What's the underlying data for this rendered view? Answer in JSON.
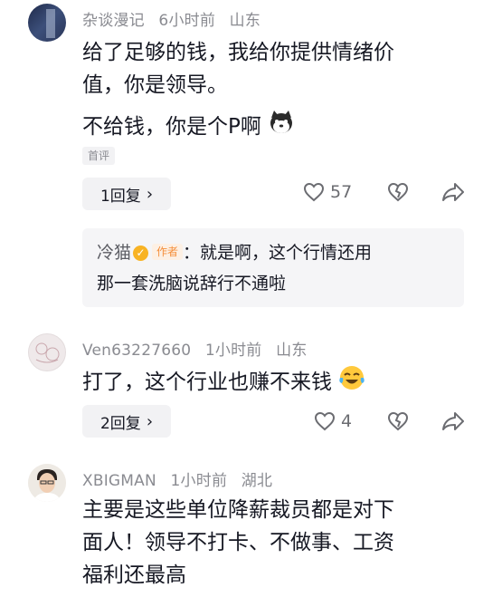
{
  "comments": [
    {
      "username": "杂谈漫记",
      "time": "6小时前",
      "location": "山东",
      "text_line1": "给了足够的钱，我给你提供情绪价",
      "text_line2": "值，你是领导。",
      "text_line3": "不给钱，你是个P啊",
      "tag": "首评",
      "replies_label": "1回复",
      "likes": "57",
      "reply": {
        "author": "冷猫",
        "author_tag": "作者",
        "line1": "：就是啊，这个行情还用",
        "line2": "那一套洗脑说辞行不通啦"
      }
    },
    {
      "username": "Ven63227660",
      "time": "1小时前",
      "location": "山东",
      "text_line1": "打了，这个行业也赚不来钱",
      "replies_label": "2回复",
      "likes": "4"
    },
    {
      "username": "XBIGMAN",
      "time": "1小时前",
      "location": "湖北",
      "text_line1": "主要是这些单位降薪裁员都是对下",
      "text_line2": "面人！领导不打卡、不做事、工资",
      "text_line3": "福利还最高"
    }
  ],
  "icons": {
    "heart": "heart-icon",
    "dislike": "broken-heart-icon",
    "share": "share-arrow-icon",
    "chevron": "chevron-right-icon"
  }
}
